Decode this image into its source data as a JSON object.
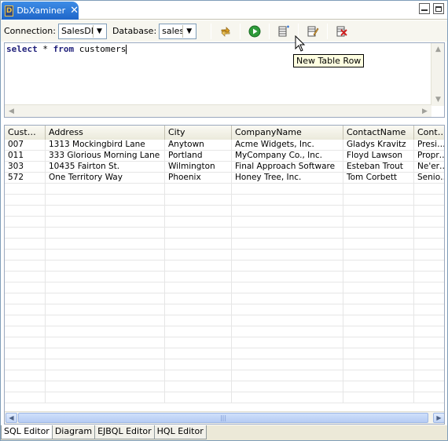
{
  "view_tab": {
    "title": "DbXaminer",
    "icon": "db-icon"
  },
  "window_controls": {
    "minimize": "minimize-icon",
    "maximize": "maximize-icon"
  },
  "toolbar": {
    "connection_label": "Connection:",
    "connection_value": "SalesDB",
    "database_label": "Database:",
    "database_value": "sales",
    "buttons": [
      "refresh-icon",
      "run-icon",
      "new-table-row-icon",
      "edit-row-icon",
      "delete-row-icon"
    ]
  },
  "editor": {
    "keyword1": "select",
    "star": " * ",
    "keyword2": "from",
    "table": " customers"
  },
  "tooltip": "New Table Row",
  "grid": {
    "columns": [
      "Cust…",
      "Address",
      "City",
      "CompanyName",
      "ContactName",
      "Cont…"
    ],
    "rows": [
      [
        "007",
        "1313 Mockingbird Lane",
        "Anytown",
        "Acme Widgets, Inc.",
        "Gladys Kravitz",
        "Presi…"
      ],
      [
        "011",
        "333 Glorious Morning Lane",
        "Portland",
        "MyCompany Co., Inc.",
        "Floyd Lawson",
        "Propr…"
      ],
      [
        "303",
        "10435 Fairton St.",
        "Wilmington",
        "Final Approach Software",
        "Esteban Trout",
        "Ne'er…"
      ],
      [
        "572",
        "One Territory Way",
        "Phoenix",
        "Honey Tree, Inc.",
        "Tom Corbett",
        "Senio…"
      ]
    ]
  },
  "bottom_tabs": [
    "SQL Editor",
    "Diagram",
    "EJBQL Editor",
    "HQL Editor"
  ],
  "colors": {
    "tab_active": "#1f66c9",
    "keyword": "#1f1f7a",
    "tooltip_bg": "#ffffe1"
  }
}
